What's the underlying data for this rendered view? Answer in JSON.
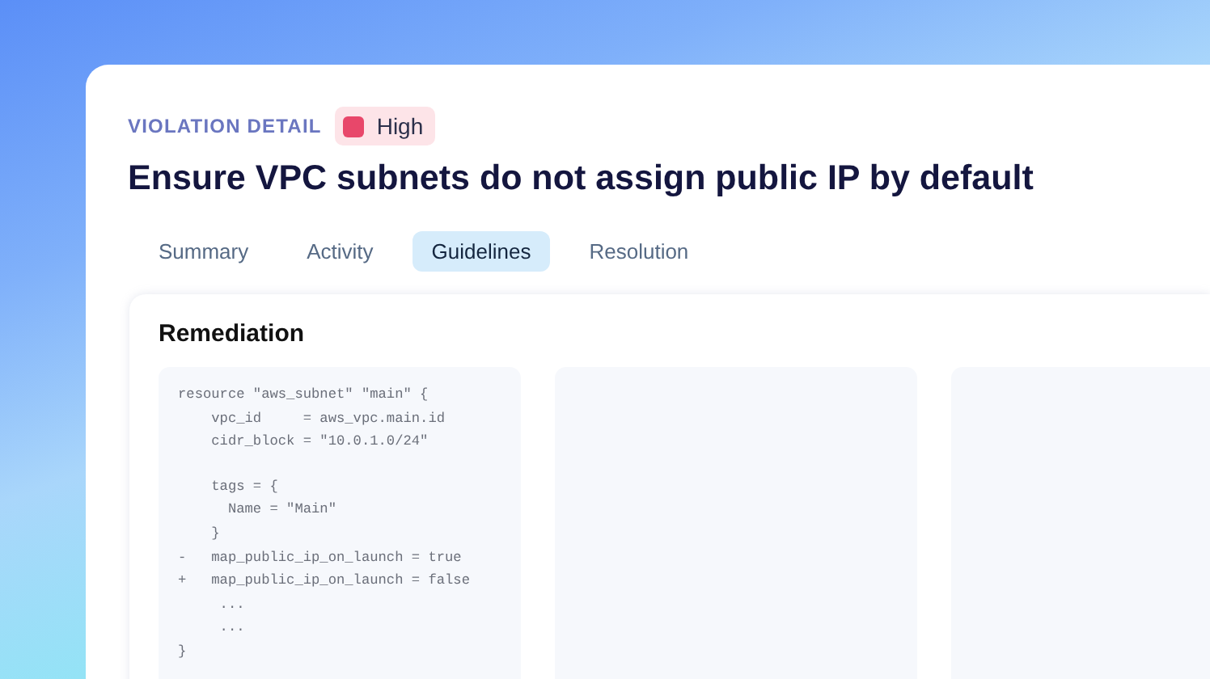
{
  "header": {
    "eyebrow": "VIOLATION DETAIL",
    "severity": {
      "label": "High",
      "color": "#e8476a"
    }
  },
  "title": "Ensure VPC subnets do not assign public IP by default",
  "tabs": [
    {
      "label": "Summary",
      "selected": false
    },
    {
      "label": "Activity",
      "selected": false
    },
    {
      "label": "Guidelines",
      "selected": true
    },
    {
      "label": "Resolution",
      "selected": false
    }
  ],
  "section": {
    "heading": "Remediation",
    "panels": [
      {
        "kind": "code",
        "lines": [
          {
            "kind": "code",
            "text": "resource \"aws_subnet\" \"main\" {"
          },
          {
            "kind": "code",
            "text": "    vpc_id     = aws_vpc.main.id"
          },
          {
            "kind": "code",
            "text": "    cidr_block = \"10.0.1.0/24\""
          },
          {
            "kind": "blank"
          },
          {
            "kind": "code",
            "text": "    tags = {"
          },
          {
            "kind": "code",
            "text": "      Name = \"Main\""
          },
          {
            "kind": "code",
            "text": "    }"
          },
          {
            "kind": "code",
            "text": "-   map_public_ip_on_launch = true"
          },
          {
            "kind": "code",
            "text": "+   map_public_ip_on_launch = false"
          },
          {
            "kind": "code",
            "text": "     ..."
          },
          {
            "kind": "code",
            "text": "     ..."
          },
          {
            "kind": "code",
            "text": "}"
          }
        ]
      },
      {
        "kind": "empty"
      },
      {
        "kind": "empty"
      }
    ]
  }
}
